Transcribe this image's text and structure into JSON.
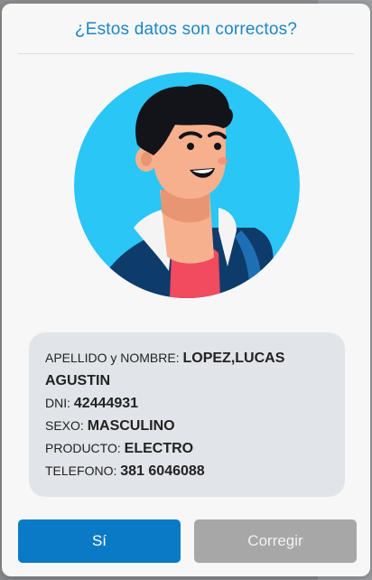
{
  "dialog": {
    "title": "¿Estos datos son correctos?",
    "avatar_icon": "user-avatar-icon"
  },
  "info": {
    "apellido_label": "APELLIDO y NOMBRE:",
    "apellido_value_1": "LOPEZ,LUCAS",
    "apellido_value_2": "AGUSTIN",
    "dni_label": "DNI:",
    "dni_value": "42444931",
    "sexo_label": "SEXO:",
    "sexo_value": "MASCULINO",
    "producto_label": "PRODUCTO:",
    "producto_value": "ELECTRO",
    "telefono_label": "TELEFONO:",
    "telefono_value": "381 6046088"
  },
  "buttons": {
    "yes_label": "Sí",
    "fix_label": "Corregir"
  },
  "colors": {
    "accent": "#1b86c6",
    "primary_button": "#0b7ac6",
    "secondary_button": "#a7a7a7",
    "avatar_bg": "#29c6f6"
  }
}
